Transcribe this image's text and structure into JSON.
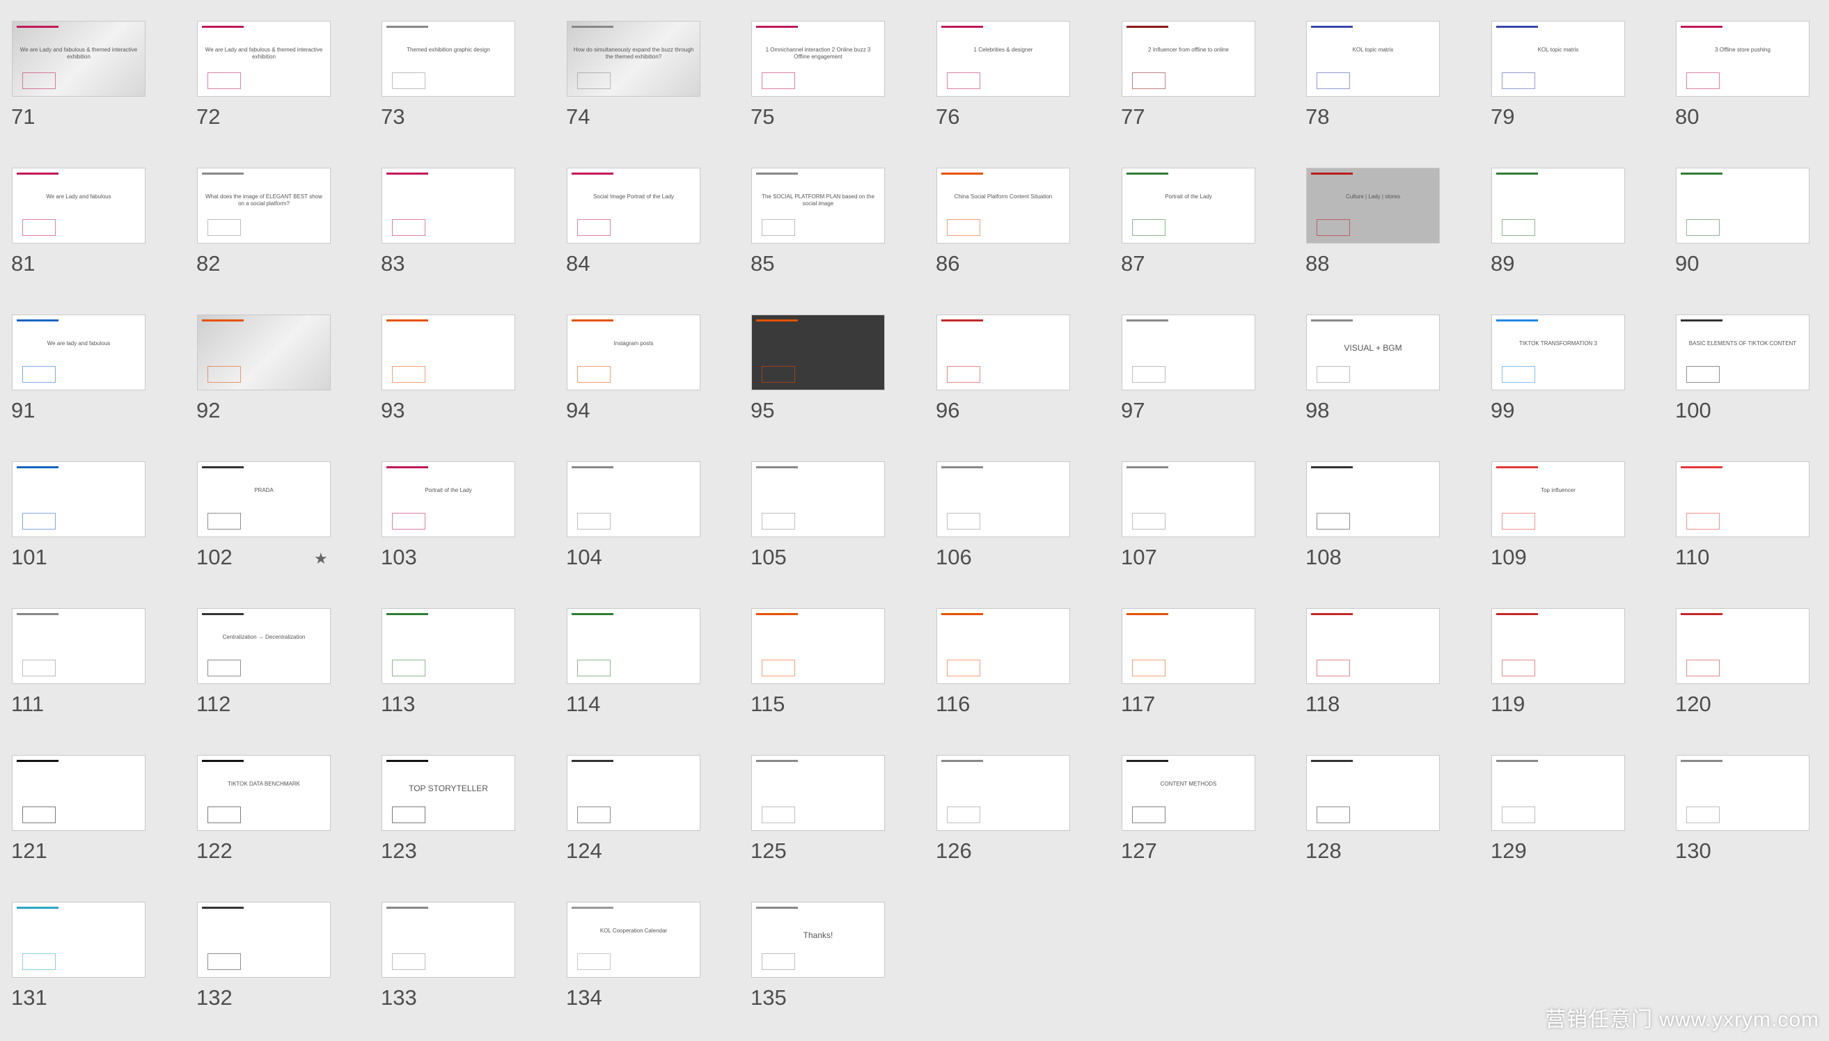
{
  "colors": {
    "background": "#e9e9e9",
    "slide_border": "#c9c9c9",
    "number_text": "#4d4d4d",
    "accent_pink": "#c2185b",
    "dark_red": "#8b1a1a"
  },
  "watermark": "营销任意门 www.yxrym.com",
  "slides": [
    {
      "n": "71",
      "style": "photo",
      "text": "We are Lady and fabulous & themed interactive exhibition",
      "accent": "#c2185b"
    },
    {
      "n": "72",
      "style": "light",
      "text": "We are Lady and fabulous & themed interactive exhibition",
      "accent": "#c2185b"
    },
    {
      "n": "73",
      "style": "light",
      "text": "Themed exhibition graphic design",
      "accent": "#888888"
    },
    {
      "n": "74",
      "style": "photo",
      "text": "How do simultaneously expand the buzz through the themed exhibition?",
      "accent": "#888888"
    },
    {
      "n": "75",
      "style": "light",
      "text": "1 Omnichannel interaction 2 Online buzz 3 Offline engagement",
      "accent": "#c2185b"
    },
    {
      "n": "76",
      "style": "light",
      "text": "1 Celebrities & designer",
      "accent": "#c2185b"
    },
    {
      "n": "77",
      "style": "light",
      "text": "2 Influencer from offline to online",
      "accent": "#8b1a1a"
    },
    {
      "n": "78",
      "style": "light",
      "text": "KOL topic matrix",
      "accent": "#3949ab"
    },
    {
      "n": "79",
      "style": "light",
      "text": "KOL topic matrix",
      "accent": "#3949ab"
    },
    {
      "n": "80",
      "style": "light",
      "text": "3 Offline store pushing",
      "accent": "#c2185b"
    },
    {
      "n": "81",
      "style": "light",
      "text": "We are Lady and fabulous",
      "accent": "#c2185b"
    },
    {
      "n": "82",
      "style": "light",
      "text": "What does the image of ELEGANT BEST show on a social platform?",
      "accent": "#888888"
    },
    {
      "n": "83",
      "style": "light",
      "text": "",
      "accent": "#c2185b"
    },
    {
      "n": "84",
      "style": "light",
      "text": "Social Image Portrait of the Lady",
      "accent": "#c2185b"
    },
    {
      "n": "85",
      "style": "light",
      "text": "The SOCIAL PLATFORM PLAN based on the social image",
      "accent": "#888888"
    },
    {
      "n": "86",
      "style": "light",
      "text": "China Social Platform Content Situation",
      "accent": "#e65100"
    },
    {
      "n": "87",
      "style": "light",
      "text": "Portrait of the Lady",
      "accent": "#2e7d32"
    },
    {
      "n": "88",
      "style": "grey",
      "text": "Culture | Lady | stores",
      "accent": "#b71c1c"
    },
    {
      "n": "89",
      "style": "light",
      "text": "",
      "accent": "#2e7d32"
    },
    {
      "n": "90",
      "style": "light",
      "text": "",
      "accent": "#2e7d32"
    },
    {
      "n": "91",
      "style": "light",
      "text": "We are lady and fabulous",
      "accent": "#1565c0"
    },
    {
      "n": "92",
      "style": "photo",
      "text": "",
      "accent": "#e65100"
    },
    {
      "n": "93",
      "style": "light",
      "text": "",
      "accent": "#e65100"
    },
    {
      "n": "94",
      "style": "light",
      "text": "Instagram posts",
      "accent": "#e65100"
    },
    {
      "n": "95",
      "style": "dark",
      "text": "",
      "accent": "#e65100"
    },
    {
      "n": "96",
      "style": "light",
      "text": "",
      "accent": "#c62828"
    },
    {
      "n": "97",
      "style": "light",
      "text": "",
      "accent": "#888888"
    },
    {
      "n": "98",
      "style": "light",
      "text": "VISUAL + BGM",
      "accent": "#888888"
    },
    {
      "n": "99",
      "style": "light",
      "text": "TIKTOK TRANSFORMATION 3",
      "accent": "#1e88e5"
    },
    {
      "n": "100",
      "style": "light",
      "text": "BASIC ELEMENTS OF TIKTOK CONTENT",
      "accent": "#333333"
    },
    {
      "n": "101",
      "style": "light",
      "text": "",
      "accent": "#1565c0"
    },
    {
      "n": "102",
      "style": "light",
      "text": "PRADA",
      "accent": "#333333",
      "starred": "★"
    },
    {
      "n": "103",
      "style": "light",
      "text": "Portrait of the Lady",
      "accent": "#c2185b"
    },
    {
      "n": "104",
      "style": "light",
      "text": "",
      "accent": "#888888"
    },
    {
      "n": "105",
      "style": "light",
      "text": "",
      "accent": "#888888"
    },
    {
      "n": "106",
      "style": "light",
      "text": "",
      "accent": "#888888"
    },
    {
      "n": "107",
      "style": "light",
      "text": "",
      "accent": "#888888"
    },
    {
      "n": "108",
      "style": "light",
      "text": "",
      "accent": "#333333"
    },
    {
      "n": "109",
      "style": "light",
      "text": "Top influencer",
      "accent": "#e53935"
    },
    {
      "n": "110",
      "style": "light",
      "text": "",
      "accent": "#e53935"
    },
    {
      "n": "111",
      "style": "light",
      "text": "",
      "accent": "#888888"
    },
    {
      "n": "112",
      "style": "light",
      "text": "Centralization → Decentralization",
      "accent": "#333333"
    },
    {
      "n": "113",
      "style": "light",
      "text": "",
      "accent": "#2e7d32"
    },
    {
      "n": "114",
      "style": "light",
      "text": "",
      "accent": "#2e7d32"
    },
    {
      "n": "115",
      "style": "light",
      "text": "",
      "accent": "#e65100"
    },
    {
      "n": "116",
      "style": "light",
      "text": "",
      "accent": "#e65100"
    },
    {
      "n": "117",
      "style": "light",
      "text": "",
      "accent": "#e65100"
    },
    {
      "n": "118",
      "style": "light",
      "text": "",
      "accent": "#c62828"
    },
    {
      "n": "119",
      "style": "light",
      "text": "",
      "accent": "#c62828"
    },
    {
      "n": "120",
      "style": "light",
      "text": "",
      "accent": "#c62828"
    },
    {
      "n": "121",
      "style": "light",
      "text": "",
      "accent": "#111111"
    },
    {
      "n": "122",
      "style": "light",
      "text": "TIKTOK DATA BENCHMARK",
      "accent": "#111111"
    },
    {
      "n": "123",
      "style": "light",
      "text": "TOP STORYTELLER",
      "accent": "#111111"
    },
    {
      "n": "124",
      "style": "light",
      "text": "",
      "accent": "#333333"
    },
    {
      "n": "125",
      "style": "light",
      "text": "",
      "accent": "#888888"
    },
    {
      "n": "126",
      "style": "light",
      "text": "",
      "accent": "#888888"
    },
    {
      "n": "127",
      "style": "light",
      "text": "CONTENT METHODS",
      "accent": "#222222"
    },
    {
      "n": "128",
      "style": "light",
      "text": "",
      "accent": "#333333"
    },
    {
      "n": "129",
      "style": "light",
      "text": "",
      "accent": "#888888"
    },
    {
      "n": "130",
      "style": "light",
      "text": "",
      "accent": "#888888"
    },
    {
      "n": "131",
      "style": "light",
      "text": "",
      "accent": "#2aa7c9"
    },
    {
      "n": "132",
      "style": "light",
      "text": "",
      "accent": "#333333"
    },
    {
      "n": "133",
      "style": "light",
      "text": "",
      "accent": "#888888"
    },
    {
      "n": "134",
      "style": "light",
      "text": "KOL Cooperation Calendar",
      "accent": "#999999"
    },
    {
      "n": "135",
      "style": "light",
      "text": "Thanks!",
      "accent": "#888888"
    }
  ]
}
